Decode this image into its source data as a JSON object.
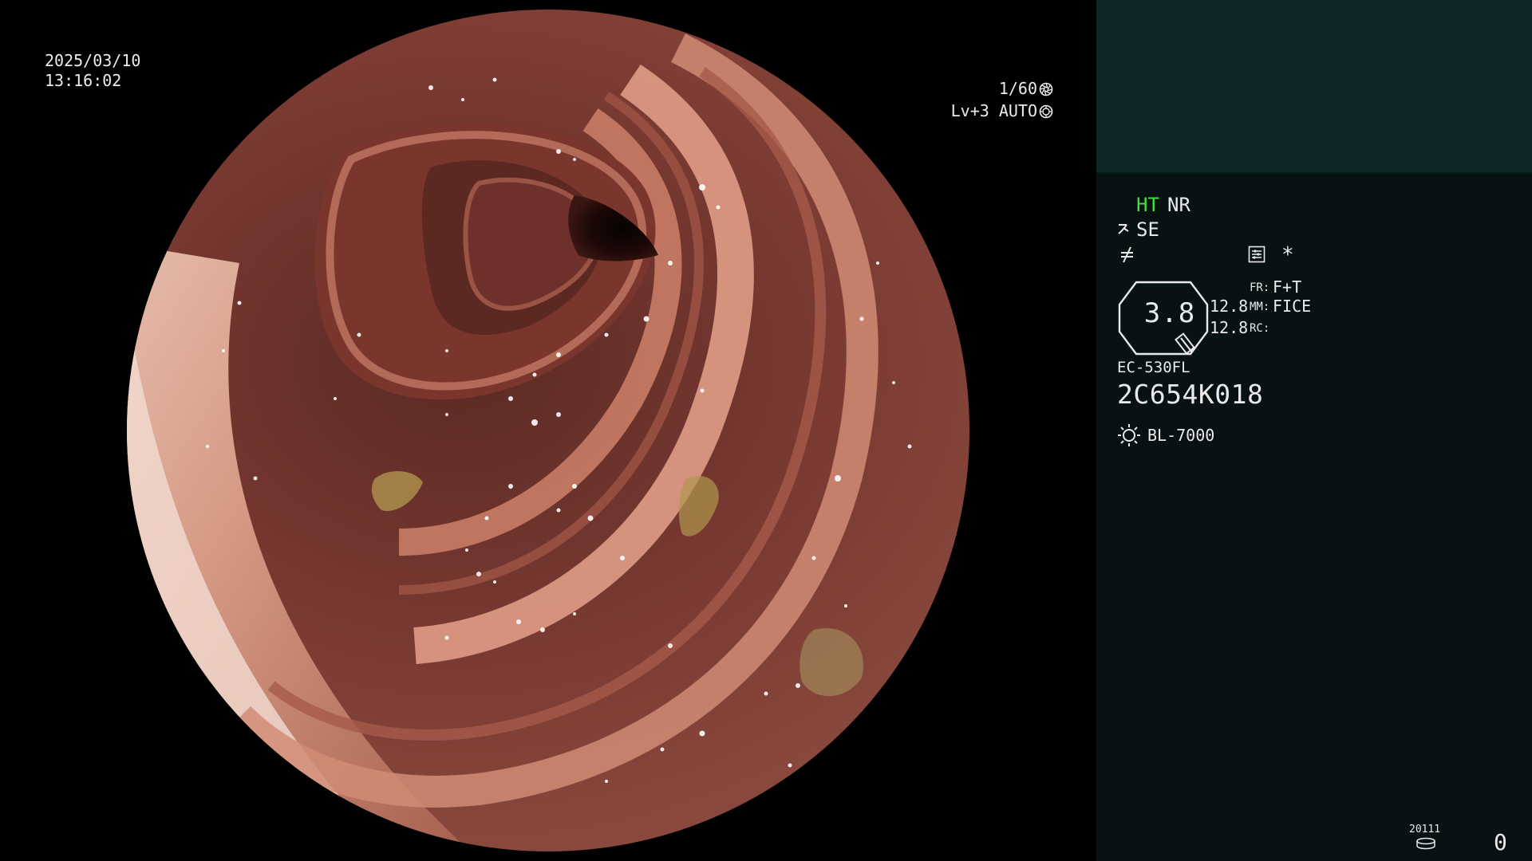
{
  "overlay": {
    "date": "2025/03/10",
    "time": "13:16:02",
    "shutter": "1/60",
    "shutter_icon": "aperture-icon",
    "level": "Lv+3 AUTO",
    "level_icon": "auto-exposure-icon"
  },
  "panel": {
    "ht_label": "HT",
    "nr_label": "NR",
    "se_label": "SE",
    "zoom_value": "3.8",
    "value_top": "12.8",
    "value_bottom": "12.8",
    "fr_key": "FR:",
    "fr_value": "F+T",
    "mm_key": "MM:",
    "mm_value": "FICE",
    "rc_key": "RC:",
    "asterisk": "*",
    "scope_model": "EC-530FL",
    "scope_serial": "2C654K018",
    "light_source": "BL-7000",
    "counter_small": "20111",
    "counter_big": "0",
    "colors": {
      "ht_green": "#3fe03f",
      "panel_header_bg": "#0d2628",
      "panel_bg": "#081212"
    }
  }
}
